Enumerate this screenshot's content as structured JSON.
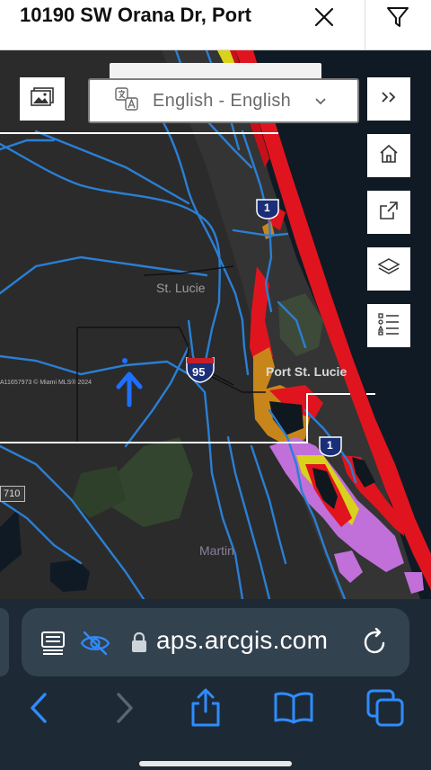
{
  "listing_header": {
    "title": "10190 SW Orana Dr, Port",
    "close_icon": "close-icon",
    "filter_icon": "filter-icon"
  },
  "map": {
    "language_select": {
      "value": "English - English",
      "icon": "translate-icon"
    },
    "controls": {
      "basemap_icon": "image-gallery-icon",
      "expand_icon": "double-chevron-right-icon",
      "home_icon": "home-icon",
      "share_icon": "share-icon",
      "layers_icon": "layers-icon",
      "legend_icon": "legend-list-icon"
    },
    "labels": {
      "county_st_lucie": "St. Lucie",
      "city_port_st_lucie": "Port St. Lucie",
      "county_martin": "Martin",
      "interstate": "95",
      "us_route_north": "1",
      "us_route_south": "1",
      "route_710": "710",
      "watermark": "A11657973 © Miami MLS® 2024"
    },
    "colors": {
      "background": "#2b2b2b",
      "ocean": "#101a24",
      "roads": "#2a7fd4",
      "flood_red": "#e0141e",
      "flood_orange": "#c8861a",
      "flood_yellow": "#d8d21c",
      "flood_purple": "#c070d8",
      "county_line": "#ffffff",
      "location_marker": "#1f6fff"
    }
  },
  "browser": {
    "url": "aps.arcgis.com",
    "icons": {
      "reader": "reader-icon",
      "privacy": "privacy-eye-slash-icon",
      "lock": "lock-icon",
      "reload": "reload-icon",
      "back": "back-chevron-icon",
      "forward": "forward-chevron-icon",
      "share": "share-icon",
      "bookmarks": "bookmarks-icon",
      "tabs": "tabs-icon"
    },
    "accent": "#2f8cff"
  }
}
